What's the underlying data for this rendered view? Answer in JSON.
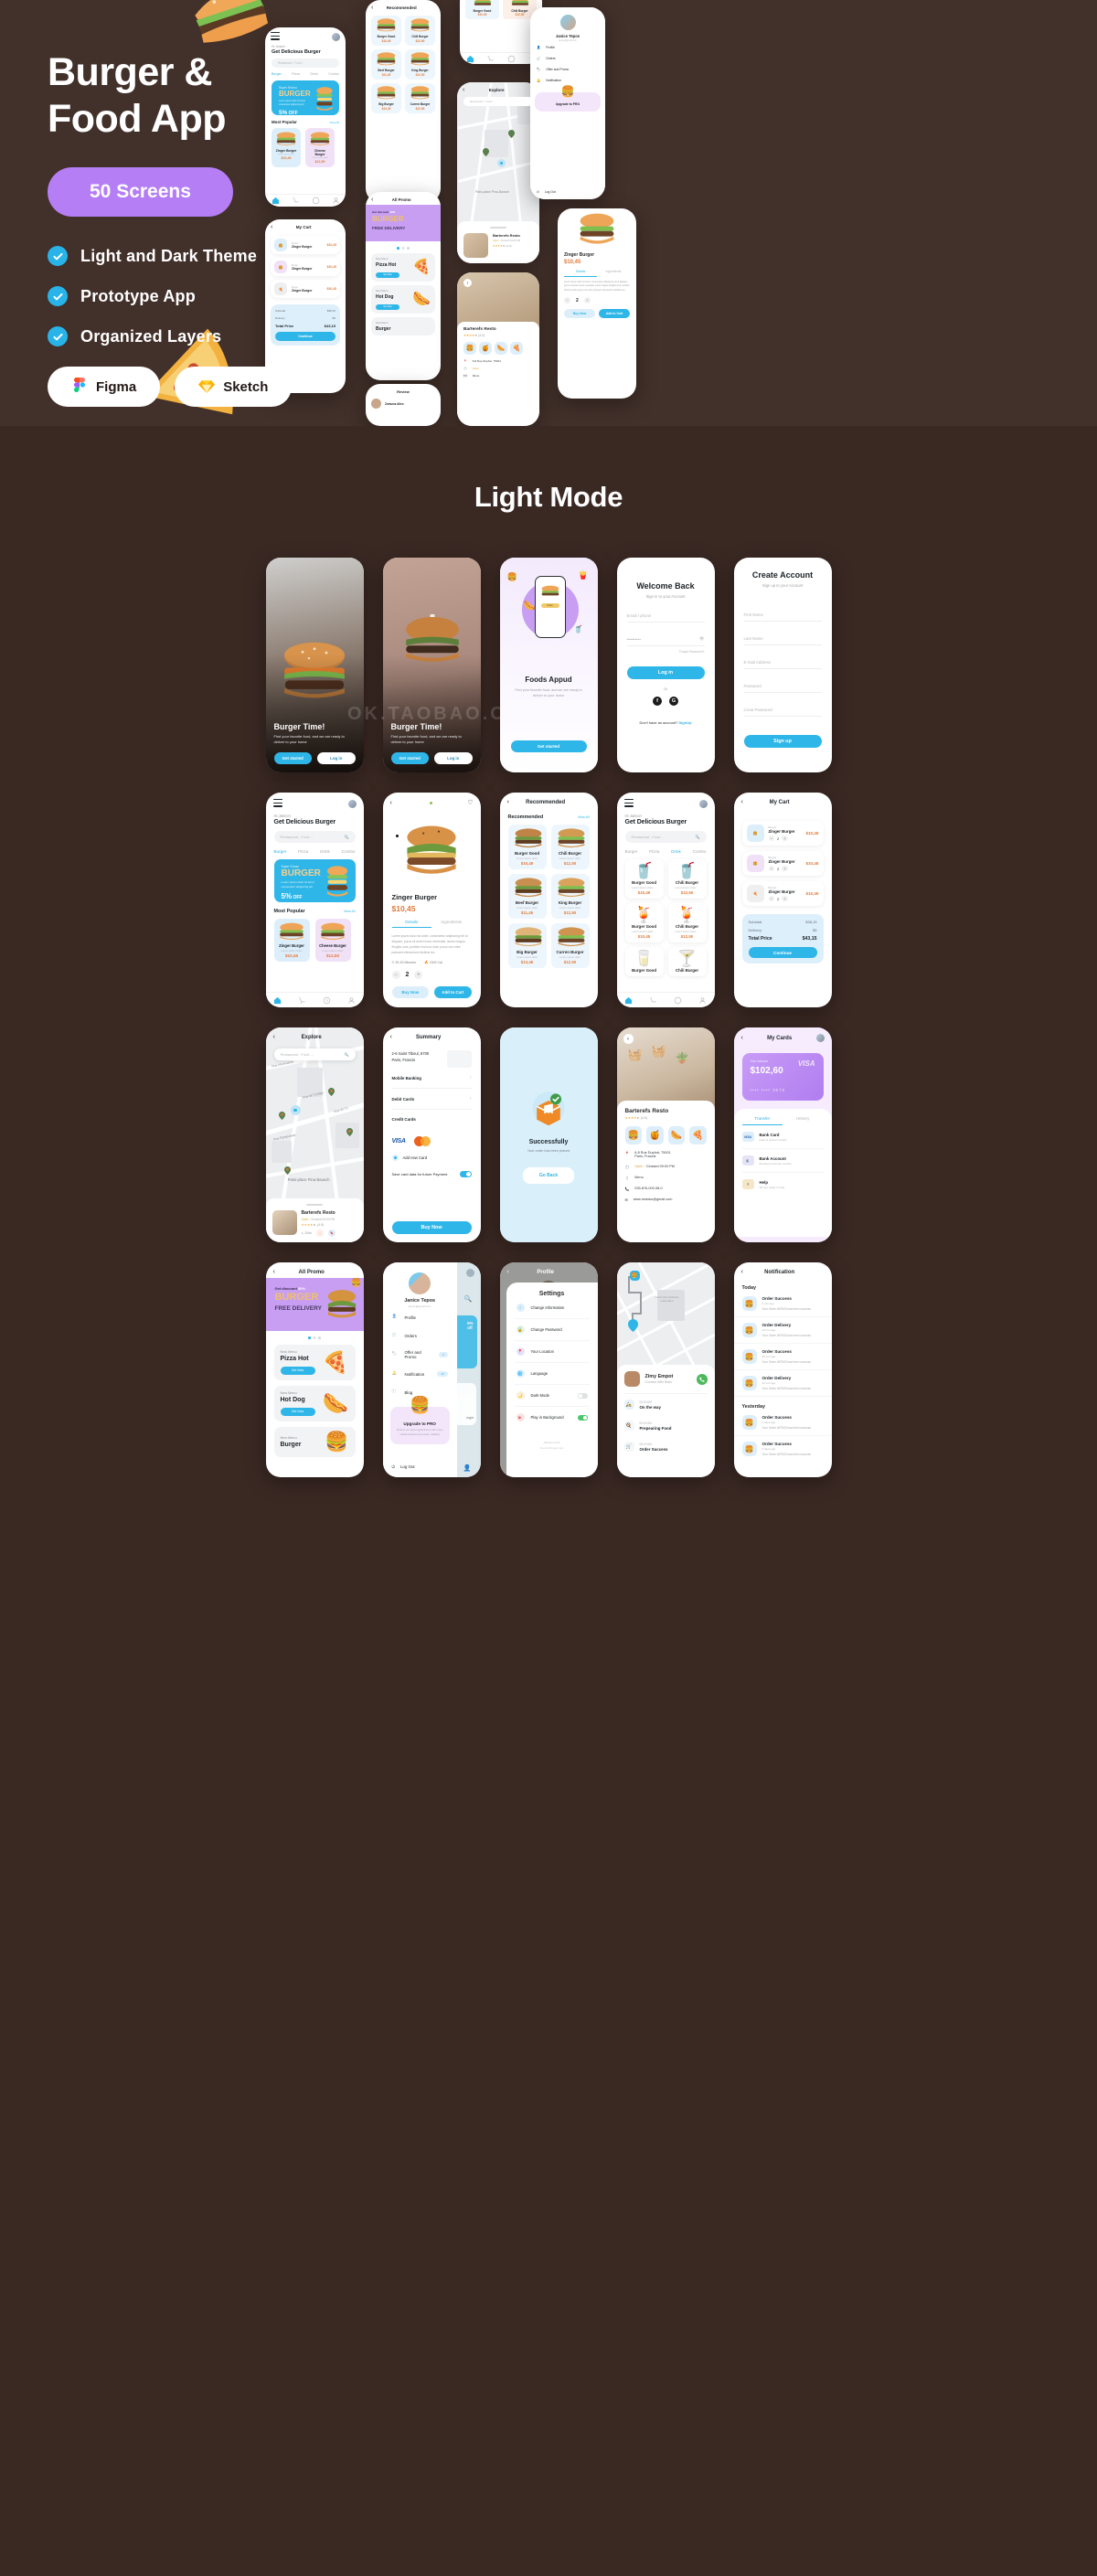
{
  "hero": {
    "title_line1": "Burger &",
    "title_line2": "Food App",
    "screens_badge": "50 Screens",
    "features": [
      {
        "label": "Light and Dark Theme",
        "icon": "check-icon"
      },
      {
        "label": "Prototype App",
        "icon": "check-icon"
      },
      {
        "label": "Organized Layers",
        "icon": "check-icon"
      }
    ],
    "tools": [
      {
        "label": "Figma",
        "icon": "figma-icon"
      },
      {
        "label": "Sketch",
        "icon": "sketch-icon"
      }
    ],
    "accent_purple": "#b57ef5",
    "accent_blue": "#28b4e8",
    "background": "#42302a"
  },
  "section": {
    "light_mode_title": "Light Mode"
  },
  "watermark": "OK.TAOBAO.COM",
  "home": {
    "greeting": "Hi Janice!",
    "headline": "Get Delicious Burger",
    "search_placeholder": "Restaurant , Food ...",
    "tabs": [
      "Burger",
      "Pizza",
      "Drink",
      "Combo"
    ],
    "active_tab": "Burger",
    "promo": {
      "eyebrow": "Super Khusu",
      "title": "BURGER",
      "desc": "Lorem ipsum dolor sit amet consectetur adipiscing elit",
      "off": "5%",
      "off_suffix": " OFF"
    },
    "most_popular_title": "Most Popular",
    "view_all": "View All",
    "popular": [
      {
        "name": "Zinger Burger",
        "sub": "Lorem ipsum dolor",
        "price": "$10,45",
        "tone": "blue"
      },
      {
        "name": "Cheese Burger",
        "sub": "Lorem ipsum dolor",
        "price": "$12,50",
        "tone": "purple"
      }
    ],
    "nav": [
      "home-icon",
      "cart-icon",
      "clock-icon",
      "user-icon"
    ]
  },
  "home_drink": {
    "greeting": "Hi Janice!",
    "headline": "Get Delicious Burger",
    "search_placeholder": "Restaurant , Food ...",
    "tabs": [
      "Burger",
      "Pizza",
      "Drink",
      "Combo"
    ],
    "active_tab": "Drink",
    "items": [
      {
        "name": "Burger Good",
        "sub": "Lorem ipsum dolor ...",
        "price": "$10,45",
        "emoji": "🥤"
      },
      {
        "name": "Chili Burger",
        "sub": "Lorem ipsum dolor ...",
        "price": "$12,50",
        "emoji": "🥤"
      },
      {
        "name": "Burger Good",
        "sub": "Lorem ipsum dolor ...",
        "price": "$10,45",
        "emoji": "🍹"
      },
      {
        "name": "Chili Burger",
        "sub": "Lorem ipsum dolor ...",
        "price": "$12,50",
        "emoji": "🍹"
      },
      {
        "name": "Burger Good",
        "sub": "Lorem ipsum dolor ...",
        "price": "$10,45",
        "emoji": "🥛"
      },
      {
        "name": "Chili Burger",
        "sub": "Lorem ipsum dolor ...",
        "price": "$12,50",
        "emoji": "🍸"
      }
    ]
  },
  "onboarding": {
    "title": "Burger Time!",
    "subtitle": "Find your favorite food, and we are ready to deliver to your home",
    "primary_btn": "Get started",
    "secondary_btn": "Log in"
  },
  "appud": {
    "title": "Foods Appud",
    "subtitle": "Find your favorite food, and we are ready to deliver to your home",
    "button": "Get started",
    "phone_chip": "Order"
  },
  "login": {
    "title": "Welcome Back",
    "subtitle": "Sign in to your Account",
    "email_placeholder": "Email / phone",
    "password_value": "••••••••••",
    "eye_icon": "eye-icon",
    "forgot": "Forgot Password?",
    "button": "Log in",
    "or": "Or",
    "socials": [
      "facebook-icon",
      "google-icon"
    ],
    "footer_text": "Don't have an account?",
    "footer_link": "SignUp"
  },
  "signup": {
    "title": "Create Account",
    "subtitle": "Sign up to your Account",
    "fields": [
      "First Name",
      "Last Name",
      "E-mail Address",
      "Password",
      "Creat Password"
    ],
    "button": "Sign up"
  },
  "product": {
    "name": "Zinger Burger",
    "price": "$10,45",
    "tabs": [
      "Details",
      "Ingredients"
    ],
    "active_tab": "Details",
    "description": "Lorem ipsum dolor sit amet, consectetur adipiscing elit ut aliquam, purus sit amet luctus venenatis, lectus magna fringilla urna, porttitor rhoncus dolor purus non enim praesent elementum facilisis leo.",
    "time": "20-30 Minutes",
    "calories": "1500 Cal",
    "quantity": "2",
    "buy_btn": "Buy Now",
    "cart_btn": "Add to Cart",
    "heart_icon": "heart-icon"
  },
  "recommended": {
    "header": "Recommended",
    "section_title": "Recommended",
    "view_all": "View All",
    "items": [
      {
        "name": "Burger Good",
        "sub": "Lorem ipsum dolor",
        "price": "$10,45"
      },
      {
        "name": "Chili Burger",
        "sub": "Lorem ipsum dolor",
        "price": "$12,50"
      },
      {
        "name": "Beef Burger",
        "sub": "Lorem ipsum dolor",
        "price": "$11,45"
      },
      {
        "name": "King Burger",
        "sub": "Lorem ipsum dolor",
        "price": "$12,50"
      },
      {
        "name": "Big Burger",
        "sub": "Lorem ipsum dolor",
        "price": "$13,45"
      },
      {
        "name": "Curren Burger",
        "sub": "Lorem ipsum dolor",
        "price": "$12,50"
      }
    ]
  },
  "cart": {
    "title": "My Cart",
    "items": [
      {
        "category": "Burger",
        "name": "Zinger Burger",
        "qty": "2",
        "price": "$10,45",
        "tone": "blue"
      },
      {
        "category": "Burger",
        "name": "Zinger Burger",
        "qty": "2",
        "price": "$10,45",
        "tone": "purple"
      },
      {
        "category": "Burger",
        "name": "Zinger Burger",
        "qty": "2",
        "price": "$10,45",
        "tone": "grey"
      }
    ],
    "subtotal_label": "Subtotal",
    "subtotal": "$38,15",
    "delivery_label": "Delivery",
    "delivery": "$5",
    "total_label": "Total Price",
    "total": "$43,15",
    "continue_btn": "Continue"
  },
  "explore": {
    "title": "Explore",
    "search_placeholder": "Restaurant , Food ...",
    "map_labels": [
      "Rue Montmartre",
      "Rue de Turbigo",
      "Rue du Cy",
      "Rue Rambuteau",
      "Patio-place Pina-Bausch",
      "Riquetonne",
      "Montorgueil"
    ],
    "resto": {
      "name": "Barterefs Resto",
      "status_open": "Open",
      "status_closed": "Clossed 09:00 PM",
      "rating": "(4.0)",
      "stars": 4,
      "distance": "200m"
    }
  },
  "summary": {
    "title": "Summary",
    "address_line1": "2-6 Saint Tiboul, 6700",
    "address_line2": "Paris, Francis",
    "rows": [
      "Mobile Banking",
      "Debit Cards",
      "Credit Cards"
    ],
    "cards": [
      "VISA",
      "mastercard"
    ],
    "add_new_card": "Add new Card",
    "save_card_label": "Save card data for future Payment",
    "save_card_on": true,
    "button": "Buy Now"
  },
  "success": {
    "title": "Successfully",
    "subtitle": "Your order has been placed",
    "button": "Go Back"
  },
  "resto": {
    "name": "Barterefs Resto",
    "rating": "(4.0)",
    "stars": 4,
    "categories": [
      "🍔",
      "🍯",
      "🌭",
      "🍕"
    ],
    "address_line1": "6-8 Rue Duphot, 75001",
    "address_line2": "Paris, Francis",
    "open_label": "Open",
    "closed_label": "Clossed 09:00 PM",
    "menu": "Menu",
    "phone": "035-876-000-98-0",
    "email": "www.restoku@gmail.com"
  },
  "mycards": {
    "title": "My Cards",
    "balance_label": "Your balance",
    "balance": "$102,60",
    "card_number": "•••• ••••  3570",
    "brand": "VISA",
    "tabs": [
      "Transfer",
      "History"
    ],
    "active_tab": "Transfer",
    "items": [
      {
        "name": "Bank Card",
        "sub": "Card or phone number",
        "badge": "VISA"
      },
      {
        "name": "Bank Account",
        "sub": "Routing & account number",
        "badge": ""
      },
      {
        "name": "Help",
        "sub": "We are ready to help",
        "badge": ""
      }
    ]
  },
  "allpromo": {
    "title": "All Promo",
    "banner": {
      "small": "Get discount",
      "percent": "30%",
      "big": "BURGER",
      "delivery": "FREE DELIVERY"
    },
    "menus": [
      {
        "eyebrow": "New Menu",
        "name": "Pizza Hot",
        "button": "Get Now",
        "emoji": "🍕"
      },
      {
        "eyebrow": "New Menu",
        "name": "Hot Dog",
        "button": "Get Now",
        "emoji": "🌭"
      },
      {
        "eyebrow": "New Menu",
        "name": "Burger",
        "button": "Get Now",
        "emoji": "🍔"
      }
    ]
  },
  "profile_drawer": {
    "name": "Janice Tepos",
    "email": "janice@gmail.com",
    "items": [
      {
        "label": "Profile",
        "icon": "user-icon",
        "badge": ""
      },
      {
        "label": "Orders",
        "icon": "cart-icon",
        "badge": ""
      },
      {
        "label": "Offer and Promo",
        "icon": "tag-icon",
        "badge": "6"
      },
      {
        "label": "Notification",
        "icon": "bell-icon",
        "badge": "15"
      },
      {
        "label": "Blog",
        "icon": "info-icon",
        "badge": ""
      }
    ],
    "pro_title": "Upgrade to PRO",
    "pro_sub": "Explore our latest applications with many updated assets and easier usability",
    "logout": "Log Out"
  },
  "settings": {
    "header": "Profile",
    "title": "Settings",
    "items": [
      {
        "label": "Change Information",
        "icon": "info-icon",
        "toggle": null
      },
      {
        "label": "Change Password",
        "icon": "lock-icon",
        "toggle": null
      },
      {
        "label": "Your Location",
        "icon": "pin-icon",
        "toggle": null
      },
      {
        "label": "Language",
        "icon": "globe-icon",
        "toggle": null
      },
      {
        "label": "Dark Mode",
        "icon": "moon-icon",
        "toggle": false
      },
      {
        "label": "Play in Background",
        "icon": "play-icon",
        "toggle": true
      }
    ],
    "version_label": "Version 1.0.2",
    "footer_note": "Food & Burger App"
  },
  "tracking": {
    "rider_name": "Zimy Empot",
    "rider_sub": "Connect With Rider",
    "call_icon": "phone-icon",
    "steps": [
      {
        "time": "09:30 AM",
        "label": "On the way",
        "icon": "scooter-icon"
      },
      {
        "time": "09:00 AM",
        "label": "Prepearing Food",
        "icon": "cook-icon"
      },
      {
        "time": "08:00 AM",
        "label": "Order Success",
        "icon": "cart-icon"
      }
    ],
    "map_label": "Jardin des Archives nationales"
  },
  "notification": {
    "title": "Notification",
    "groups": [
      {
        "label": "Today",
        "items": [
          {
            "title": "Order Success",
            "ago": "6 min ago",
            "desc": "Your Order #67543 has been success"
          },
          {
            "title": "Order Delivery",
            "ago": "12 min ago",
            "desc": "Your Order #67543 has been success"
          },
          {
            "title": "Order Success",
            "ago": "26 min ago",
            "desc": "Your Order #67543 has been success"
          },
          {
            "title": "Order Delivery",
            "ago": "31 min ago",
            "desc": "Your Order #67543 has been success"
          }
        ]
      },
      {
        "label": "Yesterday",
        "items": [
          {
            "title": "Order Success",
            "ago": "2 days ago",
            "desc": "Your Order #67543 has been success"
          },
          {
            "title": "Order Success",
            "ago": "3 days ago",
            "desc": "Your Order #67543 has been success"
          }
        ]
      }
    ]
  }
}
